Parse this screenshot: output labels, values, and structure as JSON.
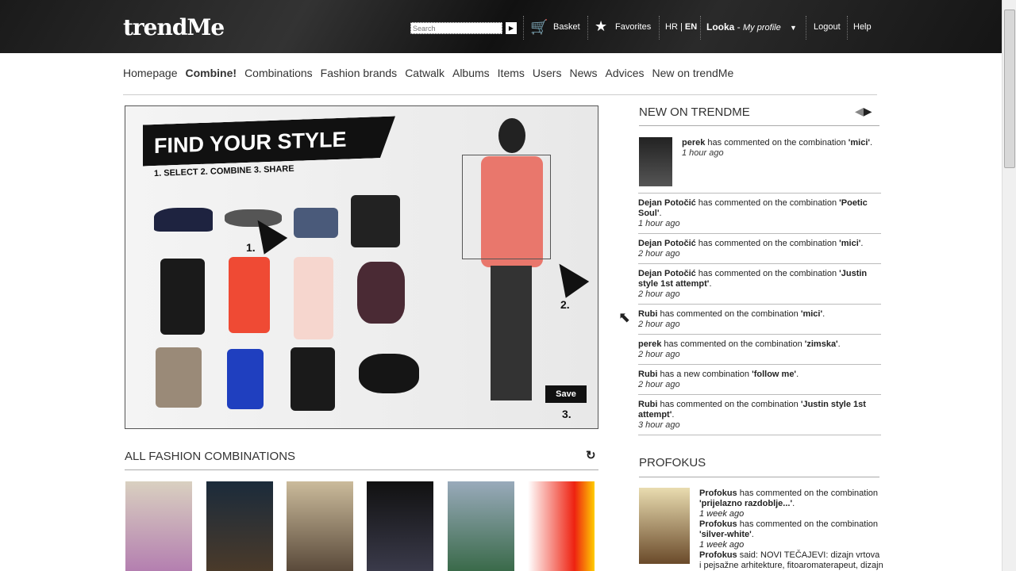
{
  "header": {
    "logo": "trendMe",
    "search_placeholder": "Search",
    "basket": "Basket",
    "favorites": "Favorites",
    "lang_hr": "HR",
    "lang_sep": " | ",
    "lang_en": "EN",
    "user": "Looka",
    "user_sep": " - ",
    "profile": "My profile",
    "logout": "Logout",
    "help": "Help"
  },
  "nav": [
    "Homepage",
    "Combine!",
    "Combinations",
    "Fashion brands",
    "Catwalk",
    "Albums",
    "Items",
    "Users",
    "News",
    "Advices",
    "New on trendMe"
  ],
  "banner": {
    "title": "FIND YOUR STYLE",
    "steps": "1. SELECT  2. COMBINE  3. SHARE",
    "n1": "1.",
    "n2": "2.",
    "n3": "3.",
    "save": "Save"
  },
  "all_combinations": {
    "title": "ALL FASHION COMBINATIONS"
  },
  "new_on": {
    "title": "NEW ON TRENDME",
    "items": [
      {
        "user": "perek",
        "text": " has commented on the combination ",
        "combo": "'mici'",
        "end": ".",
        "time": "1 hour ago"
      },
      {
        "user": "Dejan Potočić",
        "text": " has commented on the combination ",
        "combo": "'Poetic Soul'",
        "end": ".",
        "time": "1 hour ago"
      },
      {
        "user": "Dejan Potočić",
        "text": " has commented on the combination ",
        "combo": "'mici'",
        "end": ".",
        "time": "2 hour ago"
      },
      {
        "user": "Dejan Potočić",
        "text": " has commented on the combination ",
        "combo": "'Justin style 1st attempt'",
        "end": ".",
        "time": "2 hour ago"
      },
      {
        "user": "Rubi",
        "text": " has commented on the combination ",
        "combo": "'mici'",
        "end": ".",
        "time": "2 hour ago"
      },
      {
        "user": "perek",
        "text": " has commented on the combination ",
        "combo": "'zimska'",
        "end": ".",
        "time": "2 hour ago"
      },
      {
        "user": "Rubi",
        "text": " has a new combination ",
        "combo": "'follow me'",
        "end": ".",
        "time": "2 hour ago"
      },
      {
        "user": "Rubi",
        "text": " has commented on the combination ",
        "combo": "'Justin style 1st attempt'",
        "end": ".",
        "time": "3 hour ago"
      }
    ]
  },
  "profokus": {
    "title": "PROFOKUS",
    "items": [
      {
        "user": "Profokus",
        "text": " has commented on the combination ",
        "combo": "'prijelazno razdoblje...'",
        "end": ".",
        "time": "1 week ago"
      },
      {
        "user": "Profokus",
        "text": " has commented on the combination ",
        "combo": "'silver-white'",
        "end": ".",
        "time": "1 week ago"
      },
      {
        "user": "Profokus",
        "text": " said: NOVI TEČAJEVI: dizajn vrtova i pejsažne arhitekture, fitoaromaterapeut, dizajn",
        "combo": "",
        "end": "",
        "time": ""
      }
    ]
  }
}
